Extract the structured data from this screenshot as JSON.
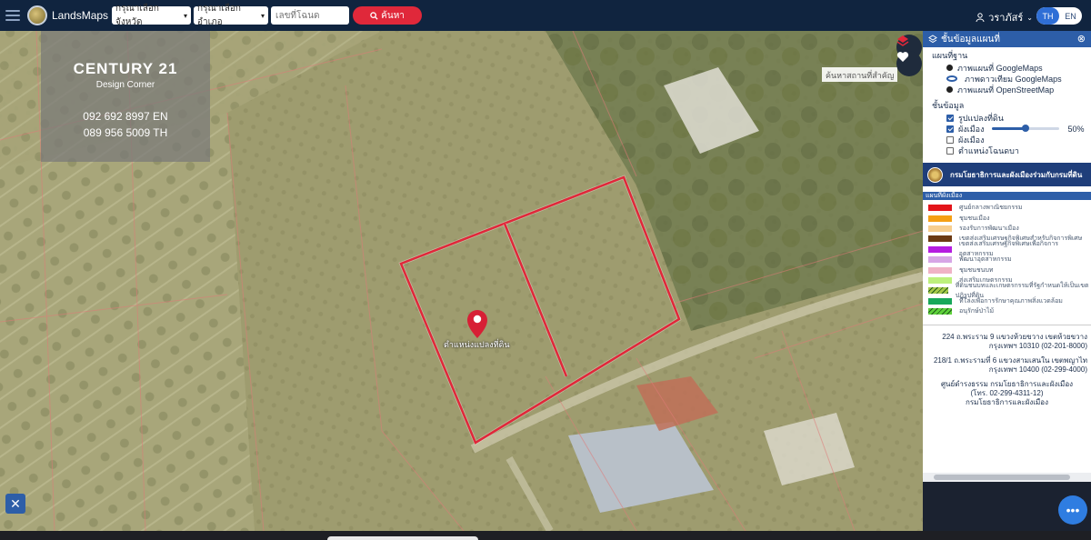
{
  "header": {
    "app_name": "LandsMaps",
    "province_select": "กรุณาเลือกจังหวัด",
    "district_select": "กรุณาเลือกอำเภอ",
    "deed_placeholder": "เลขที่โฉนด",
    "search_label": "ค้นหา",
    "user_name": "วราภัสร์",
    "lang_th": "TH",
    "lang_en": "EN"
  },
  "watermark": {
    "brand": "CENTURY 21",
    "subtitle": "Design Corner",
    "phone_en": "092 692 8997 EN",
    "phone_th": "089 956 5009 TH"
  },
  "map": {
    "place_search": "ค้นหาสถานที่สำคัญ",
    "marker_label": "ตำแหน่งแปลงที่ดิน"
  },
  "panel": {
    "title": "ชั้นข้อมูลแผนที่",
    "basemap_label": "แผนที่ฐาน",
    "basemaps": [
      {
        "label": "ภาพแผนที่ GoogleMaps",
        "selected": false
      },
      {
        "label": "ภาพดาวเทียม GoogleMaps",
        "selected": true
      },
      {
        "label": "ภาพแผนที่ OpenStreetMap",
        "selected": false
      }
    ],
    "layers_label": "ชั้นข้อมูล",
    "layers": [
      {
        "label": "รูปแปลงที่ดิน",
        "checked": true
      },
      {
        "label": "ผังเมือง",
        "checked": true
      },
      {
        "label": "ผังเมือง",
        "checked": false
      },
      {
        "label": "ตำแหน่งโฉนดบา",
        "checked": false
      }
    ],
    "opacity_percent": 50,
    "opacity_label": "50%",
    "dept_banner": "กรมโยธาธิการและผังเมืองร่วมกับกรมที่ดิน",
    "legend_title": "แผนที่ผังเมือง",
    "legend": [
      {
        "label": "ศูนย์กลางพาณิชยกรรม",
        "color": "#e3141a"
      },
      {
        "label": "ชุมชนเมือง",
        "color": "#f5a015"
      },
      {
        "label": "รองรับการพัฒนาเมือง",
        "color": "#f7ce8e"
      },
      {
        "label": "เขตส่งเสริมเศรษฐกิจพิเศษสำหรับกิจการพิเศษ",
        "color": "#6b3a13"
      },
      {
        "label": "เขตส่งเสริมเศรษฐกิจพิเศษเพื่อกิจการอุตสาหกรรม",
        "color": "#b51ce0"
      },
      {
        "label": "พัฒนาอุตสาหกรรม",
        "color": "#d7a6e6"
      },
      {
        "label": "ชุมชนชนบท",
        "color": "#f0b3c6"
      },
      {
        "label": "ส่งเสริมเกษตรกรรม",
        "color": "#bdf07d"
      },
      {
        "label": "ที่ดินชนบทและเกษตรกรรมที่รัฐกำหนดให้เป็นเขตปฏิรูปที่ดิน",
        "color": "#a7c94a"
      },
      {
        "label": "ที่โล่งเพื่อการรักษาคุณภาพสิ่งแวดล้อม",
        "color": "#18a85a"
      },
      {
        "label": "อนุรักษ์ป่าไม้",
        "color": "#5ed13b"
      }
    ],
    "addresses": [
      "224 ถ.พระราม 9 แขวงห้วยขวาง เขตห้วยขวาง กรุงเทพฯ 10310 (02-201-8000)",
      "218/1 ถ.พระรามที่ 6 แขวงสามเสนใน เขตพญาไท กรุงเทพฯ 10400 (02-299-4000)"
    ],
    "contact_center": "ศูนย์ดำรงธรรม กรมโยธาธิการและผังเมือง",
    "contact_phone": "(โทร. 02-299-4311-12)",
    "contact_dept": "กรมโยธาธิการและผังเมือง"
  },
  "colors": {
    "topbar": "#10243f",
    "accent": "#2d5ea8",
    "search": "#e0283a",
    "parcel_outline": "#e0283a"
  }
}
